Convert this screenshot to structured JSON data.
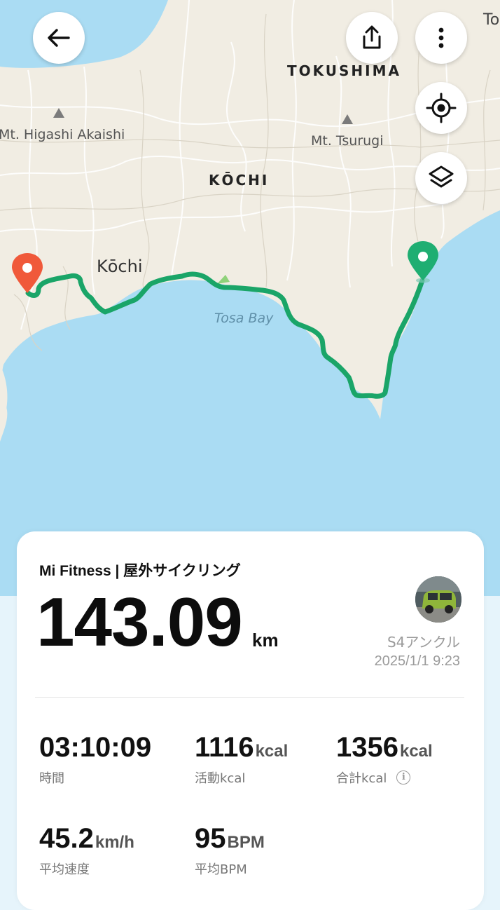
{
  "map": {
    "labels": {
      "tokushima": "TOKUSHIMA",
      "kochi_region": "KŌCHI",
      "mt_higashi_akaishi": "Mt. Higashi Akaishi",
      "mt_tsurugi": "Mt. Tsurugi",
      "kochi_city": "Kōchi",
      "tosa_bay": "Tosa Bay",
      "corner_partial": "To"
    },
    "colors": {
      "land": "#f1ede3",
      "sea": "#aadcf3",
      "route": "#1aa568",
      "start_pin": "#f0593a",
      "end_pin": "#1fae72"
    }
  },
  "controls": {
    "back_icon": "arrow-left-icon",
    "share_icon": "share-icon",
    "more_icon": "more-vertical-icon",
    "locate_icon": "locate-icon",
    "layers_icon": "layers-icon"
  },
  "summary": {
    "title": "Mi Fitness | 屋外サイクリング",
    "distance": "143.09",
    "distance_unit": "km",
    "device": "S4アンクル",
    "datetime": "2025/1/1 9:23"
  },
  "stats": [
    {
      "value": "03:10:09",
      "unit": "",
      "label": "時間"
    },
    {
      "value": "1116",
      "unit": "kcal",
      "label": "活動kcal"
    },
    {
      "value": "1356",
      "unit": "kcal",
      "label": "合計kcal"
    },
    {
      "value": "45.2",
      "unit": "km/h",
      "label": "平均速度"
    },
    {
      "value": "95",
      "unit": "BPM",
      "label": "平均BPM"
    }
  ]
}
